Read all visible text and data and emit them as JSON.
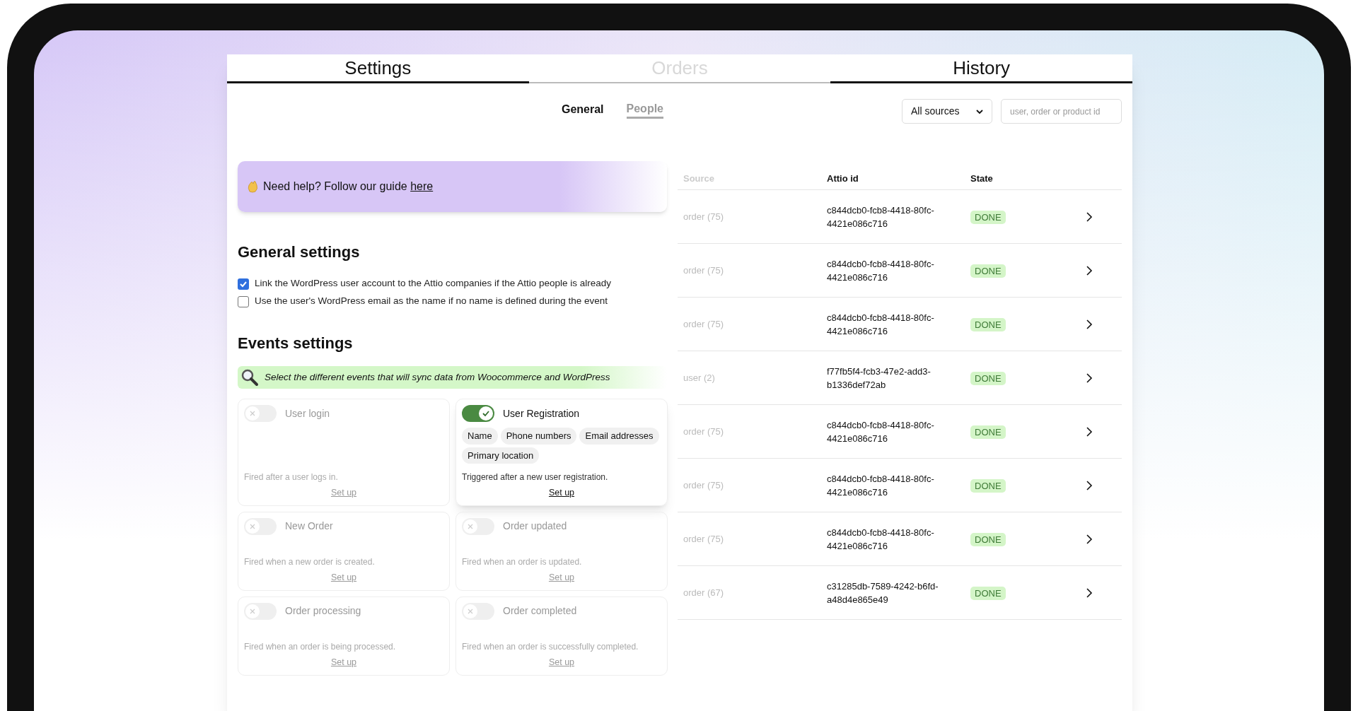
{
  "tabs": [
    {
      "label": "Settings",
      "selected": true
    },
    {
      "label": "Orders",
      "selected": false
    },
    {
      "label": "History",
      "selected": true
    }
  ],
  "subtabs": [
    {
      "label": "General",
      "selected": true
    },
    {
      "label": "People",
      "selected": false
    }
  ],
  "help_banner": {
    "text": "Need help? Follow our guide ",
    "link": "here"
  },
  "general_settings": {
    "title": "General settings",
    "options": [
      {
        "label": "Link the WordPress user account to the Attio companies if the Attio people is already",
        "checked": true
      },
      {
        "label": "Use the user's WordPress email as the name if no name is defined during the event",
        "checked": false
      }
    ]
  },
  "events_settings": {
    "title": "Events settings",
    "hint": "Select the different events that will sync data from Woocommerce and WordPress",
    "events": [
      {
        "name": "User login",
        "on": false,
        "description": "Fired after a user logs in.",
        "link": "Set up"
      },
      {
        "name": "User Registration",
        "on": true,
        "tags": [
          "Name",
          "Phone numbers",
          "Email addresses",
          "Primary location"
        ],
        "description": "Triggered after a new user registration.",
        "link": "Set up"
      },
      {
        "name": "New Order",
        "on": false,
        "description": "Fired when a new order is created.",
        "link": "Set up"
      },
      {
        "name": "Order updated",
        "on": false,
        "description": "Fired when an order is updated.",
        "link": "Set up"
      },
      {
        "name": "Order processing",
        "on": false,
        "description": "Fired when an order is being processed.",
        "link": "Set up"
      },
      {
        "name": "Order completed",
        "on": false,
        "description": "Fired when an order is successfully completed.",
        "link": "Set up"
      }
    ]
  },
  "history": {
    "source_filter": "All sources",
    "search": {
      "placeholder": "user, order or product id"
    },
    "columns": [
      "Source",
      "Attio id",
      "State"
    ],
    "rows": [
      {
        "source": "order (75)",
        "attio_id": "c844dcb0-fcb8-4418-80fc-4421e086c716",
        "state": "DONE"
      },
      {
        "source": "order (75)",
        "attio_id": "c844dcb0-fcb8-4418-80fc-4421e086c716",
        "state": "DONE"
      },
      {
        "source": "order (75)",
        "attio_id": "c844dcb0-fcb8-4418-80fc-4421e086c716",
        "state": "DONE"
      },
      {
        "source": "user (2)",
        "attio_id": "f77fb5f4-fcb3-47e2-add3-b1336def72ab",
        "state": "DONE"
      },
      {
        "source": "order (75)",
        "attio_id": "c844dcb0-fcb8-4418-80fc-4421e086c716",
        "state": "DONE"
      },
      {
        "source": "order (75)",
        "attio_id": "c844dcb0-fcb8-4418-80fc-4421e086c716",
        "state": "DONE"
      },
      {
        "source": "order (75)",
        "attio_id": "c844dcb0-fcb8-4418-80fc-4421e086c716",
        "state": "DONE"
      },
      {
        "source": "order (67)",
        "attio_id": "c31285db-7589-4242-b6fd-a48d4e865e49",
        "state": "DONE"
      }
    ]
  }
}
